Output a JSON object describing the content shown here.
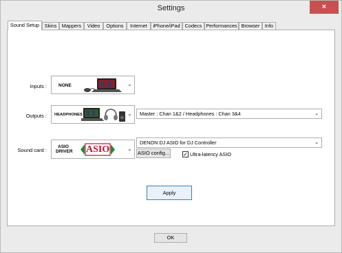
{
  "window": {
    "title": "Settings",
    "close_glyph": "×"
  },
  "tabs": [
    {
      "label": "Sound Setup",
      "active": true
    },
    {
      "label": "Skins"
    },
    {
      "label": "Mappers"
    },
    {
      "label": "Video"
    },
    {
      "label": "Options"
    },
    {
      "label": "Internet"
    },
    {
      "label": "iPhone/iPad"
    },
    {
      "label": "Codecs"
    },
    {
      "label": "Performances"
    },
    {
      "label": "Browser"
    },
    {
      "label": "Info"
    }
  ],
  "sound_setup": {
    "inputs": {
      "label": "Inputs :",
      "device_text": "NONE",
      "icon": "laptop-mouse-icon"
    },
    "outputs": {
      "label": "Outputs :",
      "device_text": "HEADPHONES",
      "icon": "laptop-headphones-speaker-icon",
      "select_value": "Master : Chan 1&2 / Headphones : Chan 3&4"
    },
    "sound_card": {
      "label": "Sound card :",
      "device_text_line1": "ASIO",
      "device_text_line2": "DRIVER",
      "logo_text": "ASIO",
      "select_value": "DENON DJ ASIO for DJ Controller",
      "config_button": "ASIO config...",
      "ultra_latency_label": "Ultra-latency ASIO",
      "ultra_latency_checked": true,
      "check_glyph": "✓"
    },
    "apply_button": "Apply"
  },
  "footer": {
    "ok_button": "OK"
  },
  "colors": {
    "close_bg": "#c75050",
    "default_button_border": "#3c7fb1",
    "asio_red": "#c8102e"
  }
}
